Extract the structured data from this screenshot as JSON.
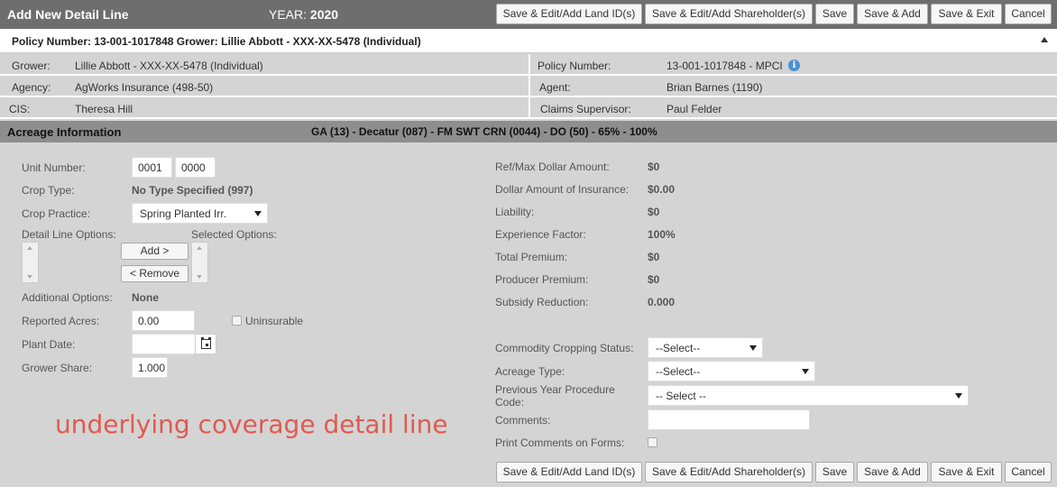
{
  "header": {
    "title": "Add New Detail Line",
    "year_label": "YEAR:",
    "year_value": "2020"
  },
  "toolbar": {
    "save_land": "Save & Edit/Add Land ID(s)",
    "save_shareholder": "Save & Edit/Add Shareholder(s)",
    "save": "Save",
    "save_add": "Save & Add",
    "save_exit": "Save & Exit",
    "cancel": "Cancel"
  },
  "policy_bar": {
    "text": "Policy Number: 13-001-1017848 Grower: Lillie Abbott - XXX-XX-5478 (Individual)"
  },
  "info": {
    "grower_label": "Grower:",
    "grower_value": "Lillie Abbott - XXX-XX-5478 (Individual)",
    "policy_label": "Policy Number:",
    "policy_value": "13-001-1017848 - MPCI",
    "agency_label": "Agency:",
    "agency_value": "AgWorks Insurance (498-50)",
    "agent_label": "Agent:",
    "agent_value": "Brian Barnes (1190)",
    "cis_label": "CIS:",
    "cis_value": "Theresa Hill",
    "claims_label": "Claims Supervisor:",
    "claims_value": "Paul Felder"
  },
  "acreage": {
    "title": "Acreage Information",
    "summary": "GA (13) - Decatur (087) - FM SWT CRN (0044) - DO (50) - 65% - 100%"
  },
  "form_left": {
    "unit_number_label": "Unit Number:",
    "unit_number_1": "0001",
    "unit_number_2": "0000",
    "crop_type_label": "Crop Type:",
    "crop_type_value": "No Type Specified (997)",
    "crop_practice_label": "Crop Practice:",
    "crop_practice_value": "Spring Planted Irr.",
    "detail_line_options_label": "Detail Line Options:",
    "selected_options_label": "Selected Options:",
    "add_button": "Add >",
    "remove_button": "< Remove",
    "additional_options_label": "Additional Options:",
    "additional_options_value": "None",
    "reported_acres_label": "Reported Acres:",
    "reported_acres_value": "0.00",
    "uninsurable_label": "Uninsurable",
    "plant_date_label": "Plant Date:",
    "plant_date_value": "",
    "grower_share_label": "Grower Share:",
    "grower_share_value": "1.000"
  },
  "form_right": {
    "ref_max_label": "Ref/Max Dollar Amount:",
    "ref_max_value": "$0",
    "dollar_insurance_label": "Dollar Amount of Insurance:",
    "dollar_insurance_value": "$0.00",
    "liability_label": "Liability:",
    "liability_value": "$0",
    "experience_label": "Experience Factor:",
    "experience_value": "100%",
    "total_premium_label": "Total Premium:",
    "total_premium_value": "$0",
    "producer_premium_label": "Producer Premium:",
    "producer_premium_value": "$0",
    "subsidy_label": "Subsidy Reduction:",
    "subsidy_value": "0.000",
    "commodity_label": "Commodity Cropping Status:",
    "commodity_value": "--Select--",
    "acreage_type_label": "Acreage Type:",
    "acreage_type_value": "--Select--",
    "prev_year_label_1": "Previous Year Procedure",
    "prev_year_label_2": "Code:",
    "prev_year_value": "-- Select --",
    "comments_label": "Comments:",
    "comments_value": "",
    "print_comments_label": "Print Comments on Forms:"
  },
  "annotation": {
    "text": "underlying coverage detail line"
  }
}
